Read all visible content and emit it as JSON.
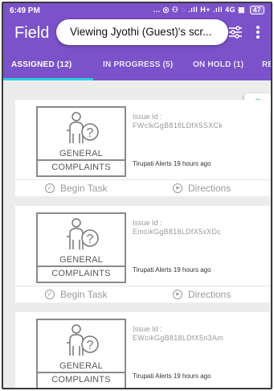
{
  "status_bar": {
    "time": "6:49 PM",
    "icons": "... ◎ ⚇ ◌ .ıll H+ .ıll 4G ▦",
    "battery": "47"
  },
  "header": {
    "app_title": "Field",
    "toast": "Viewing Jyothi (Guest)'s scr...",
    "background_color": "#7b52c9",
    "accent_color": "#2ad0e0"
  },
  "tabs": [
    {
      "label": "ASSIGNED (12)",
      "active": true
    },
    {
      "label": "IN PROGRESS (5)",
      "active": false
    },
    {
      "label": "ON HOLD (1)",
      "active": false
    },
    {
      "label": "RE",
      "active": false
    }
  ],
  "tasks": [
    {
      "category_line1": "GENERAL",
      "category_line2": "COMPLAINTS",
      "issue_label": "Issue Id :",
      "issue_id": "FWclkGgB818LDfX5SXCk",
      "alert": "Tirupati Alerts 19 hours ago",
      "begin_label": "Begin Task",
      "directions_label": "Directions"
    },
    {
      "category_line1": "GENERAL",
      "category_line2": "COMPLAINTS",
      "issue_label": "Issue Id :",
      "issue_id": "EmcikGgB818LDfX5xXDc",
      "alert": "Tirupati Alerts 19 hours ago",
      "begin_label": "Begin Task",
      "directions_label": "Directions"
    },
    {
      "category_line1": "GENERAL",
      "category_line2": "COMPLAINTS",
      "issue_label": "Issue Id :",
      "issue_id": "EWcikGgB818LDfX5n3Am",
      "alert": "Tirupati Alerts 19 hours ago"
    }
  ]
}
